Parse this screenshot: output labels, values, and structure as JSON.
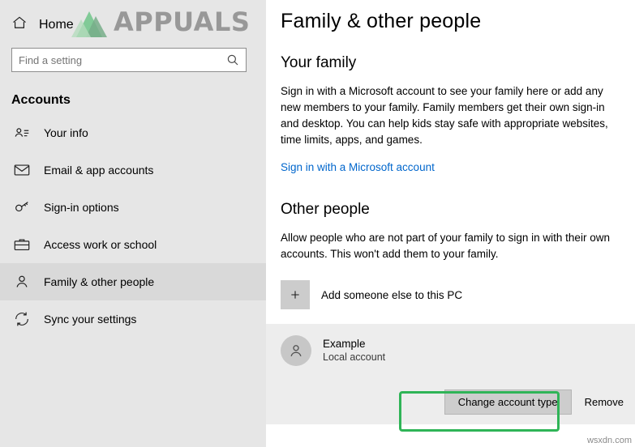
{
  "window": {
    "home_label": "Home",
    "corner_url": "wsxdn.com"
  },
  "search": {
    "placeholder": "Find a setting",
    "value": ""
  },
  "sidebar": {
    "group_title": "Accounts",
    "items": [
      {
        "label": "Your info",
        "icon": "user-card-icon",
        "selected": false
      },
      {
        "label": "Email & app accounts",
        "icon": "mail-icon",
        "selected": false
      },
      {
        "label": "Sign-in options",
        "icon": "key-icon",
        "selected": false
      },
      {
        "label": "Access work or school",
        "icon": "briefcase-icon",
        "selected": false
      },
      {
        "label": "Family & other people",
        "icon": "person-icon",
        "selected": true
      },
      {
        "label": "Sync your settings",
        "icon": "sync-icon",
        "selected": false
      }
    ]
  },
  "main": {
    "title": "Family & other people",
    "family": {
      "heading": "Your family",
      "body": "Sign in with a Microsoft account to see your family here or add any new members to your family. Family members get their own sign-in and desktop. You can help kids stay safe with appropriate websites, time limits, apps, and games.",
      "link": "Sign in with a Microsoft account"
    },
    "other_people": {
      "heading": "Other people",
      "body": "Allow people who are not part of your family to sign in with their own accounts. This won't add them to your family.",
      "add_label": "Add someone else to this PC",
      "add_icon": "plus-icon",
      "account": {
        "name": "Example",
        "type": "Local account",
        "avatar_icon": "avatar-person-icon",
        "change_button": "Change account type",
        "remove_button": "Remove"
      }
    }
  },
  "annotation": {
    "highlight_color": "#2fb457",
    "highlight_target": "change-account-type-button"
  },
  "watermark": {
    "text": "APPUALS"
  }
}
